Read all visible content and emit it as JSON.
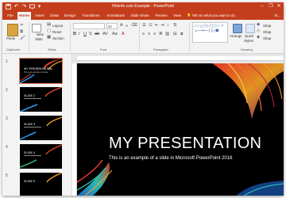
{
  "window": {
    "title": "Fileinfo.com Example - PowerPoint",
    "minimize_icon": "minimize-icon",
    "restore_icon": "restore-icon",
    "close_icon": "close-icon"
  },
  "quick_access": [
    "save-icon",
    "undo-icon",
    "redo-icon",
    "present-icon",
    "customize-icon"
  ],
  "tabs": [
    {
      "label": "File",
      "active": false
    },
    {
      "label": "Home",
      "active": true
    },
    {
      "label": "Insert",
      "active": false
    },
    {
      "label": "Draw",
      "active": false
    },
    {
      "label": "Design",
      "active": false
    },
    {
      "label": "Transitions",
      "active": false
    },
    {
      "label": "Animations",
      "active": false
    },
    {
      "label": "Slide Show",
      "active": false
    },
    {
      "label": "Review",
      "active": false
    },
    {
      "label": "View",
      "active": false
    }
  ],
  "tell_me": "Tell me what you want to do",
  "sign_in": "Si...",
  "ribbon": {
    "clipboard": {
      "paste": "Paste",
      "label": "Clipboard"
    },
    "slides": {
      "new_slide": "New",
      "new_slide_2": "Slide",
      "layout": "Layout",
      "reset": "Reset",
      "section": "Section",
      "label": "Slides"
    },
    "font": {
      "label": "Font",
      "size": "24"
    },
    "paragraph": {
      "label": "Paragraph"
    },
    "drawing": {
      "arrange": "Arrange",
      "quick_styles": "Quick",
      "quick_styles_2": "Styles",
      "shape_1": "Shap",
      "shape_2": "Shap",
      "shape_3": "Shap",
      "label": "Drawing"
    }
  },
  "thumbnails": [
    {
      "num": "1",
      "title": "MY PRESENTATION",
      "subtitle": "This is an example of a slide",
      "selected": true
    },
    {
      "num": "2",
      "title": "SLIDE 2",
      "subtitle": "",
      "selected": false
    },
    {
      "num": "3",
      "title": "SLIDE 3",
      "subtitle": "",
      "selected": false
    },
    {
      "num": "4",
      "title": "SLIDE 4",
      "subtitle": "",
      "selected": false
    },
    {
      "num": "5",
      "title": "SLIDE 5",
      "subtitle": "",
      "selected": false
    }
  ],
  "slide": {
    "title": "MY PRESENTATION",
    "subtitle": "This is an example of a slide in Microsoft PowerPoint 2016"
  },
  "colors": {
    "accent": "#c43e1c",
    "slide_bg": "#000000"
  }
}
